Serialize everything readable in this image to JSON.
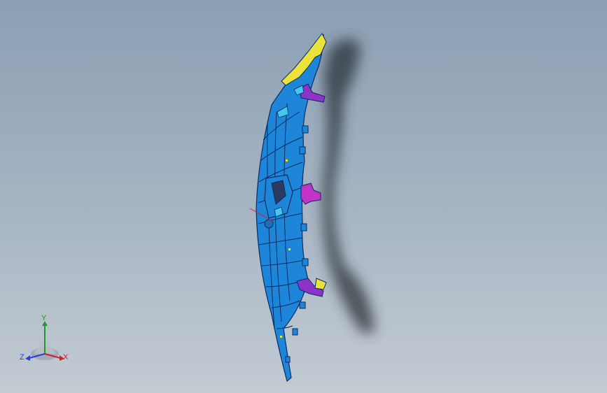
{
  "viewport": {
    "background_top": "#8b9fb4",
    "background_bottom": "#c3cbd3"
  },
  "model": {
    "colors": {
      "main": "#1e86d8",
      "outline": "#0a2a5e",
      "yellow": "#e9e33c",
      "purple": "#8d33c9",
      "magenta": "#c233c8",
      "cyan": "#45c6ee",
      "shadow": "#2b3038"
    }
  },
  "triad": {
    "y_label": "Y",
    "x_label": "X",
    "z_label": "Z",
    "colors": {
      "y": "#1f9b2a",
      "x": "#d3202a",
      "z": "#2a3fcf"
    }
  }
}
